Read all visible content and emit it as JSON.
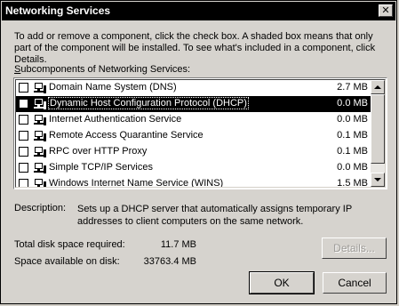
{
  "window": {
    "title": "Networking Services",
    "close_glyph": "✕"
  },
  "instructions": "To add or remove a component, click the check box. A shaded box means that only part of the component will be installed. To see what's included in a component, click Details.",
  "subcomponents_label_prefix": "S",
  "subcomponents_label_rest": "ubcomponents of Networking Services:",
  "items": [
    {
      "name": "Domain Name System (DNS)",
      "size": "2.7 MB",
      "checked": false,
      "selected": false
    },
    {
      "name": "Dynamic Host Configuration Protocol (DHCP)",
      "size": "0.0 MB",
      "checked": false,
      "selected": true
    },
    {
      "name": "Internet Authentication Service",
      "size": "0.0 MB",
      "checked": false,
      "selected": false
    },
    {
      "name": "Remote Access Quarantine Service",
      "size": "0.1 MB",
      "checked": false,
      "selected": false
    },
    {
      "name": "RPC over HTTP Proxy",
      "size": "0.1 MB",
      "checked": false,
      "selected": false
    },
    {
      "name": "Simple TCP/IP Services",
      "size": "0.0 MB",
      "checked": false,
      "selected": false
    },
    {
      "name": "Windows Internet Name Service (WINS)",
      "size": "1.5 MB",
      "checked": false,
      "selected": false
    }
  ],
  "description_label": "Description:",
  "description_text": "Sets up a DHCP server that automatically assigns temporary IP addresses to client computers on the same network.",
  "total_disk_label": "Total disk space required:",
  "total_disk_value": "11.7 MB",
  "available_disk_label": "Space available on disk:",
  "available_disk_value": "33763.4 MB",
  "buttons": {
    "details": "Details...",
    "ok": "OK",
    "cancel": "Cancel"
  },
  "colors": {
    "title_bar": "#000000",
    "dialog_bg": "#d6d3ce",
    "selection": "#000000"
  }
}
